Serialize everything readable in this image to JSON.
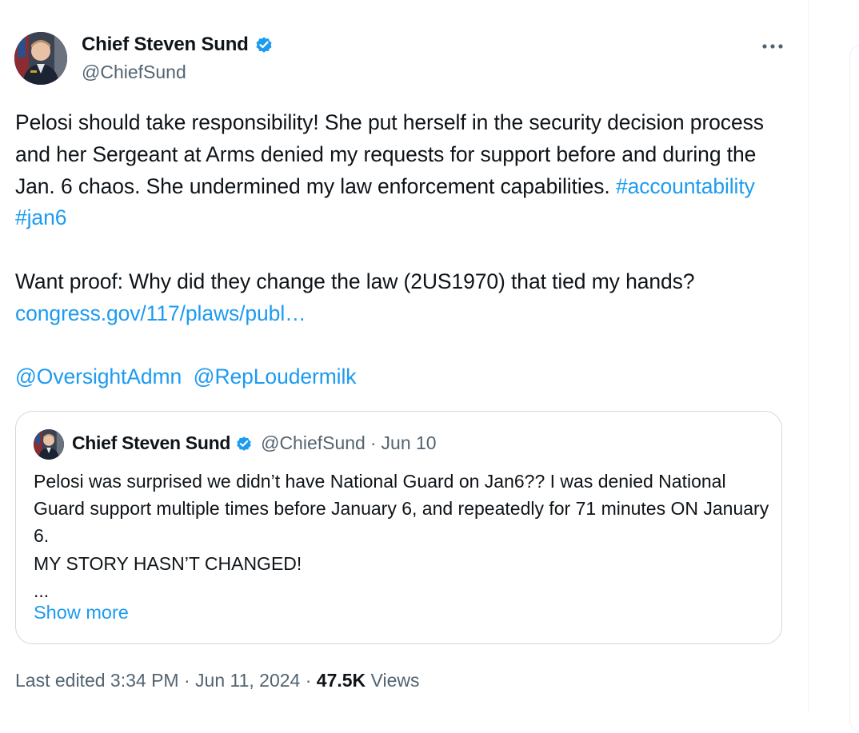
{
  "tweet": {
    "author_name": "Chief Steven Sund",
    "author_handle": "@ChiefSund",
    "paragraph1": "Pelosi should take responsibility! She put herself in the security decision process and her Sergeant at Arms denied my requests for support before and during the Jan. 6 chaos. She undermined my law enforcement capabilities.",
    "hashtag1": "#accountability",
    "hashtag2": "#jan6",
    "paragraph2": "Want proof: Why did they change the law (2US1970) that tied my hands?",
    "link": "congress.gov/117/plaws/publ…",
    "mention1": "@OversightAdmn",
    "mention2": "@RepLoudermilk"
  },
  "quote": {
    "author_name": "Chief Steven Sund",
    "author_handle": "@ChiefSund",
    "separator": "·",
    "date": "Jun 10",
    "line1": "Pelosi was surprised we didn’t have National Guard on Jan6?? I was denied National Guard support multiple times before January 6, and repeatedly for 71 minutes ON January 6.",
    "line2": "MY STORY HASN’T CHANGED!",
    "ellipsis": "...",
    "show_more": "Show more"
  },
  "meta": {
    "edited_label": "Last edited 3:34 PM",
    "sep1": " · ",
    "date": "Jun 11, 2024",
    "sep2": " · ",
    "views_count": "47.5K",
    "views_label": "Views"
  },
  "colors": {
    "link": "#1d9bf0",
    "verified": "#1d9bf0",
    "secondary_text": "#536471",
    "border": "#cfd9de"
  },
  "icons": {
    "verified": "verified-badge-icon",
    "more": "more-horizontal-icon"
  }
}
